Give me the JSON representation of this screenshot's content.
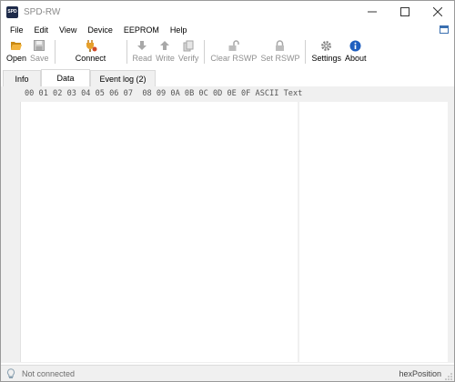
{
  "window": {
    "title": "SPD-RW",
    "icon_text": "SPD"
  },
  "menu": [
    "File",
    "Edit",
    "View",
    "Device",
    "EEPROM",
    "Help"
  ],
  "toolbar": {
    "open": "Open",
    "save": "Save",
    "connect": "Connect",
    "read": "Read",
    "write": "Write",
    "verify": "Verify",
    "clear_rswp": "Clear RSWP",
    "set_rswp": "Set RSWP",
    "settings": "Settings",
    "about": "About"
  },
  "tabs": [
    "Info",
    "Data",
    "Event log (2)"
  ],
  "active_tab": "Data",
  "hex": {
    "header": "00 01 02 03 04 05 06 07  08 09 0A 0B 0C 0D 0E 0F",
    "ascii_header": "ASCII Text"
  },
  "status": {
    "text": "Not connected",
    "position_label": "hexPosition"
  },
  "colors": {
    "window_bg": "#ffffff",
    "panel_bg": "#f0f0f0",
    "about_icon": "#1f5fbf",
    "open_icon": "#e8a020"
  }
}
